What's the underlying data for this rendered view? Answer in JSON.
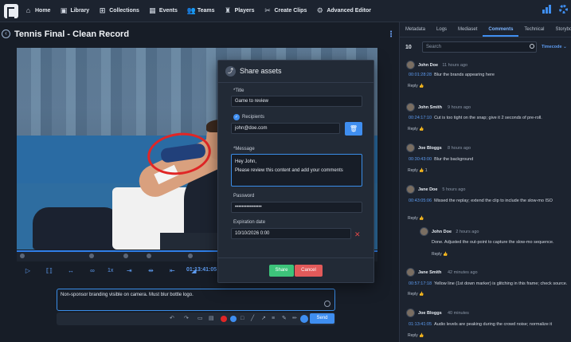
{
  "nav": {
    "items": [
      {
        "label": "Home",
        "icon": "home-icon",
        "glyph": "⌂"
      },
      {
        "label": "Library",
        "icon": "library-icon",
        "glyph": "▣"
      },
      {
        "label": "Collections",
        "icon": "collections-icon",
        "glyph": "⊞"
      },
      {
        "label": "Events",
        "icon": "events-icon",
        "glyph": "▦"
      },
      {
        "label": "Teams",
        "icon": "teams-icon",
        "glyph": "👥"
      },
      {
        "label": "Players",
        "icon": "players-icon",
        "glyph": "♜"
      },
      {
        "label": "Create Clips",
        "icon": "scissors-icon",
        "glyph": "✂"
      },
      {
        "label": "Advanced Editor",
        "icon": "editor-icon",
        "glyph": "⚙"
      }
    ]
  },
  "page": {
    "title": "Tennis Final - Clean Record",
    "accent": "#3f8ef0"
  },
  "player": {
    "speed": "1x",
    "current_time": "01:13:41:05",
    "separator": "/"
  },
  "comment_entry": {
    "text": "Non-sponsor branding visible on camera. Must blur bottle logo.",
    "send_label": "Send"
  },
  "modal": {
    "title": "Share assets",
    "title_label": "*Title",
    "title_value": "Game to review",
    "recipients_label": "Recipients",
    "recipient_value": "john@doe.com",
    "message_label": "*Message",
    "message_line1": "Hey John,",
    "message_line2": "Please review this content and add your comments",
    "password_label": "Password",
    "password_value": "••••••••••••••••",
    "expiration_label": "Expiration date",
    "expiration_value": "10/10/2026 0:00",
    "share_label": "Share",
    "cancel_label": "Cancel"
  },
  "right_panel": {
    "tabs": [
      {
        "label": "Metadata",
        "active": false
      },
      {
        "label": "Logs",
        "active": false
      },
      {
        "label": "Mediaset",
        "active": false
      },
      {
        "label": "Comments",
        "active": true
      },
      {
        "label": "Technical",
        "active": false
      },
      {
        "label": "Storyboa",
        "active": false
      }
    ],
    "count": "10",
    "search_placeholder": "Search",
    "timecode_select": "Timecode",
    "reply_label": "Reply",
    "comments": [
      {
        "author": "John Doe",
        "time": "11 hours ago",
        "timecode": "00:01:28:28",
        "text": "Blur the brands appearing here",
        "likes": ""
      },
      {
        "author": "John Smith",
        "time": "9 hours ago",
        "timecode": "00:24:17:10",
        "text": "Cut is too tight on the snap; give it 2 seconds of pre-roll.",
        "likes": ""
      },
      {
        "author": "Joe Bloggs",
        "time": "8 hours ago",
        "timecode": "00:30:43:00",
        "text": "Blur the background",
        "likes": "1"
      },
      {
        "author": "Jane Doe",
        "time": "5 hours ago",
        "timecode": "00:43:05:06",
        "text": "Missed the replay; extend the clip to include the slow-mo ISO",
        "likes": ""
      },
      {
        "author": "John Doe",
        "time": "2 hours ago",
        "timecode": "",
        "text": "Done. Adjusted the out-point to capture the slow-mo sequence.",
        "likes": ""
      },
      {
        "author": "Jane Smith",
        "time": "42 minutes ago",
        "timecode": "00:57:17:18",
        "text": "Yellow line (1st down marker) is glitching in this frame; check source.",
        "likes": ""
      },
      {
        "author": "Joe Bloggs",
        "time": "40 minutes",
        "timecode": "01:13:41:05",
        "text": "Audio levels are peaking during the crowd noise; normalize it",
        "likes": ""
      }
    ]
  }
}
